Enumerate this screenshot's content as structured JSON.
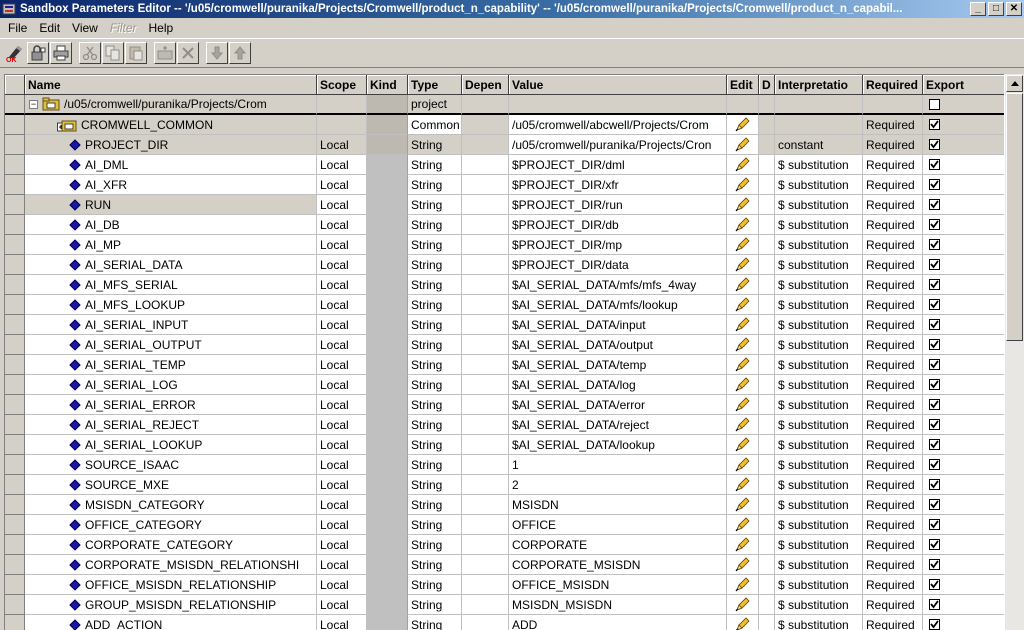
{
  "window": {
    "title": "Sandbox Parameters Editor -- '/u05/cromwell/puranika/Projects/Cromwell/product_n_capability' -- '/u05/cromwell/puranika/Projects/Cromwell/product_n_capabil...",
    "minimize_glyph": "_",
    "maximize_glyph": "□",
    "close_glyph": "✕"
  },
  "menu": {
    "file": "File",
    "edit": "Edit",
    "view": "View",
    "filter": "Filter",
    "help": "Help"
  },
  "toolbar": {
    "icons": [
      "ok-icon",
      "lock-icon",
      "save-icon",
      "print-icon",
      "cut-icon",
      "copy-icon",
      "paste-icon",
      "new-parameter-icon",
      "delete-icon",
      "move-down-icon",
      "move-up-icon"
    ]
  },
  "columns": {
    "name": "Name",
    "scope": "Scope",
    "kind": "Kind",
    "type": "Type",
    "depen": "Depen",
    "value": "Value",
    "edit": "Edit",
    "d": "D",
    "interpretation": "Interpretatio",
    "required": "Required",
    "export": "Export"
  },
  "project_row": {
    "expander": "−",
    "name": "/u05/cromwell/puranika/Projects/Crom",
    "type": "project",
    "export_checked": false
  },
  "common_row": {
    "name": "CROMWELL_COMMON",
    "type": "Common",
    "value": "/u05/cromwell/abcwell/Projects/Crom",
    "required": "Required",
    "export_checked": true
  },
  "rows": [
    {
      "name": "PROJECT_DIR",
      "scope": "Local",
      "type": "String",
      "value": "/u05/cromwell/puranika/Projects/Cron",
      "interpretation": "constant",
      "required": "Required",
      "export_checked": true,
      "shaded": true
    },
    {
      "name": "AI_DML",
      "scope": "Local",
      "type": "String",
      "value": "$PROJECT_DIR/dml",
      "interpretation": "$ substitution",
      "required": "Required",
      "export_checked": true
    },
    {
      "name": "AI_XFR",
      "scope": "Local",
      "type": "String",
      "value": "$PROJECT_DIR/xfr",
      "interpretation": "$ substitution",
      "required": "Required",
      "export_checked": true
    },
    {
      "name": "RUN",
      "scope": "Local",
      "type": "String",
      "value": "$PROJECT_DIR/run",
      "interpretation": "$ substitution",
      "required": "Required",
      "export_checked": true,
      "name_selected": true
    },
    {
      "name": "AI_DB",
      "scope": "Local",
      "type": "String",
      "value": "$PROJECT_DIR/db",
      "interpretation": "$ substitution",
      "required": "Required",
      "export_checked": true
    },
    {
      "name": "AI_MP",
      "scope": "Local",
      "type": "String",
      "value": "$PROJECT_DIR/mp",
      "interpretation": "$ substitution",
      "required": "Required",
      "export_checked": true
    },
    {
      "name": "AI_SERIAL_DATA",
      "scope": "Local",
      "type": "String",
      "value": "$PROJECT_DIR/data",
      "interpretation": "$ substitution",
      "required": "Required",
      "export_checked": true
    },
    {
      "name": "AI_MFS_SERIAL",
      "scope": "Local",
      "type": "String",
      "value": "$AI_SERIAL_DATA/mfs/mfs_4way",
      "interpretation": "$ substitution",
      "required": "Required",
      "export_checked": true
    },
    {
      "name": "AI_MFS_LOOKUP",
      "scope": "Local",
      "type": "String",
      "value": "$AI_SERIAL_DATA/mfs/lookup",
      "interpretation": "$ substitution",
      "required": "Required",
      "export_checked": true
    },
    {
      "name": "AI_SERIAL_INPUT",
      "scope": "Local",
      "type": "String",
      "value": "$AI_SERIAL_DATA/input",
      "interpretation": "$ substitution",
      "required": "Required",
      "export_checked": true
    },
    {
      "name": "AI_SERIAL_OUTPUT",
      "scope": "Local",
      "type": "String",
      "value": "$AI_SERIAL_DATA/output",
      "interpretation": "$ substitution",
      "required": "Required",
      "export_checked": true
    },
    {
      "name": "AI_SERIAL_TEMP",
      "scope": "Local",
      "type": "String",
      "value": "$AI_SERIAL_DATA/temp",
      "interpretation": "$ substitution",
      "required": "Required",
      "export_checked": true
    },
    {
      "name": "AI_SERIAL_LOG",
      "scope": "Local",
      "type": "String",
      "value": "$AI_SERIAL_DATA/log",
      "interpretation": "$ substitution",
      "required": "Required",
      "export_checked": true
    },
    {
      "name": "AI_SERIAL_ERROR",
      "scope": "Local",
      "type": "String",
      "value": "$AI_SERIAL_DATA/error",
      "interpretation": "$ substitution",
      "required": "Required",
      "export_checked": true
    },
    {
      "name": "AI_SERIAL_REJECT",
      "scope": "Local",
      "type": "String",
      "value": "$AI_SERIAL_DATA/reject",
      "interpretation": "$ substitution",
      "required": "Required",
      "export_checked": true
    },
    {
      "name": "AI_SERIAL_LOOKUP",
      "scope": "Local",
      "type": "String",
      "value": "$AI_SERIAL_DATA/lookup",
      "interpretation": "$ substitution",
      "required": "Required",
      "export_checked": true
    },
    {
      "name": "SOURCE_ISAAC",
      "scope": "Local",
      "type": "String",
      "value": "1",
      "interpretation": "$ substitution",
      "required": "Required",
      "export_checked": true
    },
    {
      "name": "SOURCE_MXE",
      "scope": "Local",
      "type": "String",
      "value": "2",
      "interpretation": "$ substitution",
      "required": "Required",
      "export_checked": true
    },
    {
      "name": "MSISDN_CATEGORY",
      "scope": "Local",
      "type": "String",
      "value": "MSISDN",
      "interpretation": "$ substitution",
      "required": "Required",
      "export_checked": true
    },
    {
      "name": "OFFICE_CATEGORY",
      "scope": "Local",
      "type": "String",
      "value": "OFFICE",
      "interpretation": "$ substitution",
      "required": "Required",
      "export_checked": true
    },
    {
      "name": "CORPORATE_CATEGORY",
      "scope": "Local",
      "type": "String",
      "value": "CORPORATE",
      "interpretation": "$ substitution",
      "required": "Required",
      "export_checked": true
    },
    {
      "name": "CORPORATE_MSISDN_RELATIONSHI",
      "scope": "Local",
      "type": "String",
      "value": "CORPORATE_MSISDN",
      "interpretation": "$ substitution",
      "required": "Required",
      "export_checked": true
    },
    {
      "name": "OFFICE_MSISDN_RELATIONSHIP",
      "scope": "Local",
      "type": "String",
      "value": "OFFICE_MSISDN",
      "interpretation": "$ substitution",
      "required": "Required",
      "export_checked": true
    },
    {
      "name": "GROUP_MSISDN_RELATIONSHIP",
      "scope": "Local",
      "type": "String",
      "value": "MSISDN_MSISDN",
      "interpretation": "$ substitution",
      "required": "Required",
      "export_checked": true
    },
    {
      "name": "ADD_ACTION",
      "scope": "Local",
      "type": "String",
      "value": "ADD",
      "interpretation": "$ substitution",
      "required": "Required",
      "export_checked": true
    }
  ],
  "colors": {
    "title_gradient_start": "#0a246a",
    "title_gradient_end": "#a6caf0",
    "chrome": "#d4d0c8",
    "parameter_icon": "#1a1aa0",
    "pencil": "#f0c030"
  }
}
